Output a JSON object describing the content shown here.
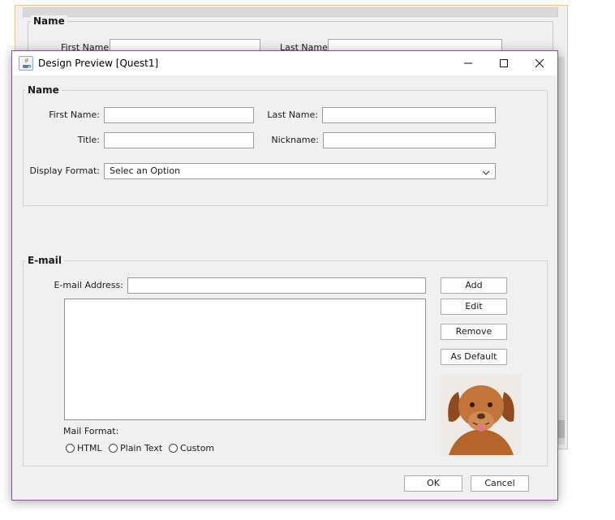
{
  "background_form": {
    "group_title": "Name",
    "first_name_label": "First Name:",
    "last_name_label": "Last Name:"
  },
  "dialog": {
    "title": "Design Preview [Quest1]",
    "app_icon": "java-coffee-cup-icon",
    "controls": [
      "minimize-icon",
      "maximize-icon",
      "close-icon"
    ]
  },
  "name_group": {
    "title": "Name",
    "first_name_label": "First Name:",
    "first_name_value": "",
    "last_name_label": "Last Name:",
    "last_name_value": "",
    "title_label": "Title:",
    "title_value": "",
    "nickname_label": "Nickname:",
    "nickname_value": "",
    "display_format_label": "Display Format:",
    "display_format_value": "Selec an Option"
  },
  "email_group": {
    "title": "E-mail",
    "address_label": "E-mail Address:",
    "address_value": "",
    "buttons": {
      "add": "Add",
      "edit": "Edit",
      "remove": "Remove",
      "as_default": "As Default"
    },
    "mail_format_label": "Mail Format:",
    "formats": [
      "HTML",
      "Plain Text",
      "Custom"
    ],
    "photo": "dog-photo"
  },
  "footer": {
    "ok": "OK",
    "cancel": "Cancel"
  },
  "colors": {
    "window_border": "#7b5b8a",
    "panel_bg": "#f0f0f0",
    "designer_border": "#f3c48a"
  }
}
